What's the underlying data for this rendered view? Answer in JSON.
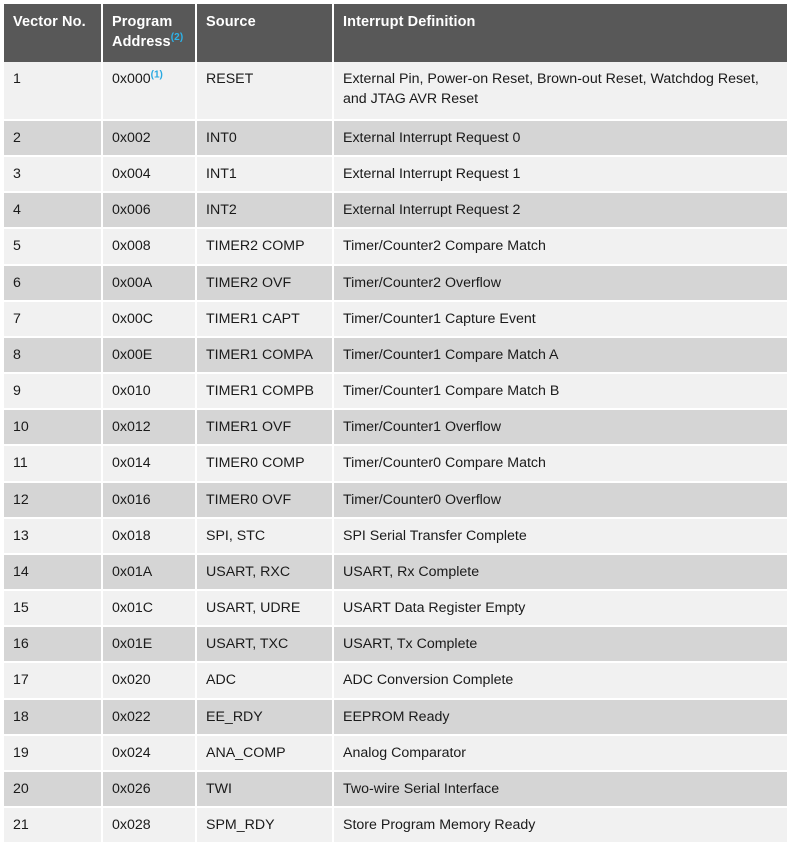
{
  "table": {
    "name": "interrupt-vector-table",
    "columns": [
      {
        "label": "Vector No.",
        "note": ""
      },
      {
        "label": "Program Address",
        "note": "(2)"
      },
      {
        "label": "Source",
        "note": ""
      },
      {
        "label": "Interrupt Definition",
        "note": ""
      }
    ],
    "colors": {
      "header_bg": "#585858",
      "header_text": "#ffffff",
      "row_odd_bg": "#f1f1f1",
      "row_even_bg": "#d5d5d5",
      "superscript": "#29a9e1",
      "grid": "#ffffff",
      "text": "#1a1a1a"
    },
    "rows": [
      {
        "vector": "1",
        "address": "0x000",
        "address_note": "(1)",
        "source": "RESET",
        "definition": "External Pin, Power-on Reset, Brown-out Reset, Watchdog Reset, and JTAG AVR Reset"
      },
      {
        "vector": "2",
        "address": "0x002",
        "address_note": "",
        "source": "INT0",
        "definition": "External Interrupt Request 0"
      },
      {
        "vector": "3",
        "address": "0x004",
        "address_note": "",
        "source": "INT1",
        "definition": "External Interrupt Request 1"
      },
      {
        "vector": "4",
        "address": "0x006",
        "address_note": "",
        "source": "INT2",
        "definition": "External Interrupt Request 2"
      },
      {
        "vector": "5",
        "address": "0x008",
        "address_note": "",
        "source": "TIMER2 COMP",
        "definition": "Timer/Counter2 Compare Match"
      },
      {
        "vector": "6",
        "address": "0x00A",
        "address_note": "",
        "source": "TIMER2 OVF",
        "definition": "Timer/Counter2 Overflow"
      },
      {
        "vector": "7",
        "address": "0x00C",
        "address_note": "",
        "source": "TIMER1 CAPT",
        "definition": "Timer/Counter1 Capture Event"
      },
      {
        "vector": "8",
        "address": "0x00E",
        "address_note": "",
        "source": "TIMER1 COMPA",
        "definition": "Timer/Counter1 Compare Match A"
      },
      {
        "vector": "9",
        "address": "0x010",
        "address_note": "",
        "source": "TIMER1 COMPB",
        "definition": "Timer/Counter1 Compare Match B"
      },
      {
        "vector": "10",
        "address": "0x012",
        "address_note": "",
        "source": "TIMER1 OVF",
        "definition": "Timer/Counter1 Overflow"
      },
      {
        "vector": "11",
        "address": "0x014",
        "address_note": "",
        "source": "TIMER0 COMP",
        "definition": "Timer/Counter0 Compare Match"
      },
      {
        "vector": "12",
        "address": "0x016",
        "address_note": "",
        "source": "TIMER0 OVF",
        "definition": "Timer/Counter0 Overflow"
      },
      {
        "vector": "13",
        "address": "0x018",
        "address_note": "",
        "source": "SPI, STC",
        "definition": "SPI Serial Transfer Complete"
      },
      {
        "vector": "14",
        "address": "0x01A",
        "address_note": "",
        "source": "USART, RXC",
        "definition": "USART, Rx Complete"
      },
      {
        "vector": "15",
        "address": "0x01C",
        "address_note": "",
        "source": "USART, UDRE",
        "definition": "USART Data Register Empty"
      },
      {
        "vector": "16",
        "address": "0x01E",
        "address_note": "",
        "source": "USART, TXC",
        "definition": "USART, Tx Complete"
      },
      {
        "vector": "17",
        "address": "0x020",
        "address_note": "",
        "source": "ADC",
        "definition": "ADC Conversion Complete"
      },
      {
        "vector": "18",
        "address": "0x022",
        "address_note": "",
        "source": "EE_RDY",
        "definition": "EEPROM Ready"
      },
      {
        "vector": "19",
        "address": "0x024",
        "address_note": "",
        "source": "ANA_COMP",
        "definition": "Analog Comparator"
      },
      {
        "vector": "20",
        "address": "0x026",
        "address_note": "",
        "source": "TWI",
        "definition": "Two-wire Serial Interface"
      },
      {
        "vector": "21",
        "address": "0x028",
        "address_note": "",
        "source": "SPM_RDY",
        "definition": "Store Program Memory Ready"
      }
    ]
  }
}
